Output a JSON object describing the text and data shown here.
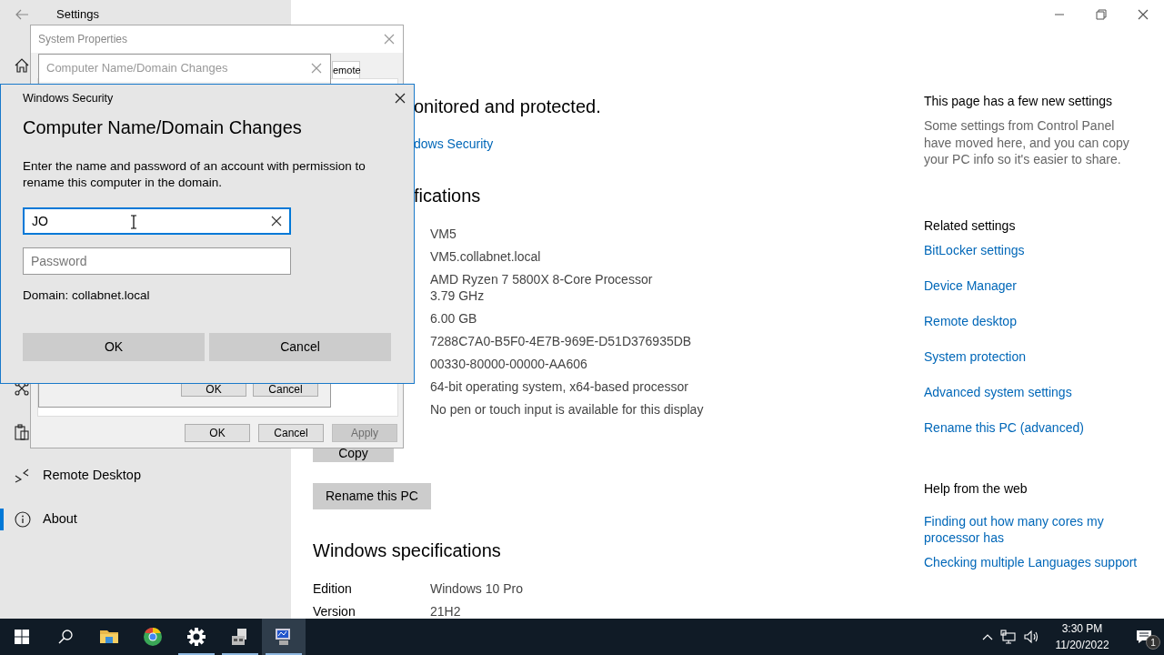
{
  "settings": {
    "title": "Settings",
    "sidebar": {
      "items": [
        {
          "label": "Remote Desktop",
          "selected": false
        },
        {
          "label": "About",
          "selected": true
        }
      ]
    },
    "about": {
      "status_heading": "onitored and protected.",
      "security_link": "dows Security",
      "specs_heading": "fications",
      "spec_values": [
        "VM5",
        "VM5.collabnet.local",
        "AMD Ryzen 7 5800X 8-Core Processor\n3.79 GHz",
        "6.00 GB",
        "7288C7A0-B5F0-4E7B-969E-D51D376935DB",
        "00330-80000-00000-AA606",
        "64-bit operating system, x64-based processor",
        "No pen or touch input is available for this display"
      ],
      "copy_button": "Copy",
      "rename_button": "Rename this PC",
      "windows_heading": "Windows specifications",
      "windows_specs": [
        {
          "label": "Edition",
          "value": "Windows 10 Pro"
        },
        {
          "label": "Version",
          "value": "21H2"
        }
      ]
    },
    "side_panel": {
      "new_title": "This page has a few new settings",
      "new_text": "Some settings from Control Panel have moved here, and you can copy your PC info so it's easier to share.",
      "related_title": "Related settings",
      "related_links": [
        "BitLocker settings",
        "Device Manager",
        "Remote desktop",
        "System protection",
        "Advanced system settings",
        "Rename this PC (advanced)"
      ],
      "help_title": "Help from the web",
      "help_links": [
        "Finding out how many cores my processor has",
        "Checking multiple Languages support"
      ]
    }
  },
  "system_properties": {
    "title": "System Properties",
    "tab": "emote",
    "buttons": [
      {
        "label": "OK",
        "disabled": false
      },
      {
        "label": "Cancel",
        "disabled": false
      },
      {
        "label": "Apply",
        "disabled": true
      }
    ],
    "name_dialog": {
      "title": "Computer Name/Domain Changes",
      "buttons": [
        "OK",
        "Cancel"
      ]
    }
  },
  "security_dialog": {
    "title": "Windows Security",
    "heading": "Computer Name/Domain Changes",
    "message": "Enter the name and password of an account with permission to rename this computer in the domain.",
    "username": {
      "value": "JO"
    },
    "password": {
      "placeholder": "Password"
    },
    "domain": "Domain: collabnet.local",
    "buttons": [
      "OK",
      "Cancel"
    ]
  },
  "taskbar": {
    "apps": [
      {
        "kind": "folder",
        "running": false,
        "active": false
      },
      {
        "kind": "browser",
        "running": false,
        "active": false
      },
      {
        "kind": "gear",
        "running": true,
        "active": false
      },
      {
        "kind": "printer",
        "running": true,
        "active": false
      },
      {
        "kind": "monitor",
        "running": true,
        "active": true
      }
    ],
    "time": "3:30 PM",
    "date": "11/20/2022",
    "notification_count": "1"
  }
}
